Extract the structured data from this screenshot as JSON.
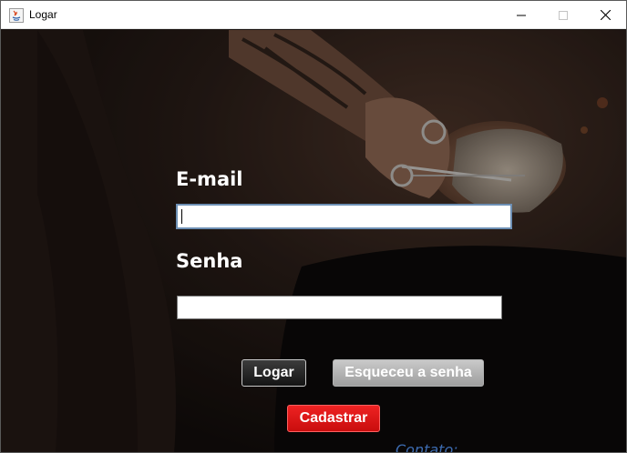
{
  "window": {
    "title": "Logar",
    "icon": "java-app-icon",
    "controls": [
      "minimize-icon",
      "maximize-icon",
      "close-icon"
    ]
  },
  "form": {
    "email_label": "E-mail",
    "email_value": "",
    "password_label": "Senha",
    "password_value": ""
  },
  "buttons": {
    "login_label": "Logar",
    "forgot_label": "Esqueceu a senha",
    "register_label": "Cadastrar"
  },
  "background": {
    "footer_text": "Contato:"
  },
  "colors": {
    "register_button": "#e01818",
    "login_button": "#1e1e1e",
    "forgot_button": "#b4b4b4"
  }
}
